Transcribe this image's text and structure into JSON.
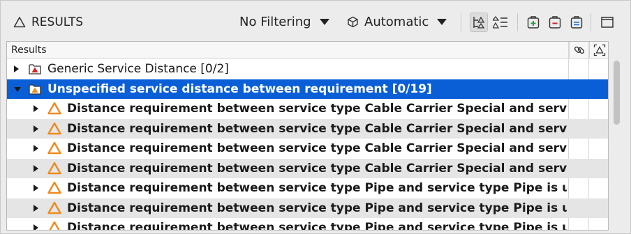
{
  "toolbar": {
    "title": "RESULTS",
    "filter_label": "No Filtering",
    "mode_label": "Automatic",
    "buttons": [
      "hierarchy-icon",
      "sort-list-icon",
      "expand-all-icon",
      "collapse-all-icon",
      "select-all-icon",
      "maximize-icon"
    ]
  },
  "table": {
    "header": "Results",
    "col_link_icon": "link-icon",
    "col_focus_icon": "focus-icon",
    "rows": [
      {
        "label": "Generic Service Distance [0/2]",
        "level": 0,
        "expanded": false,
        "icon": "folder-error-icon"
      },
      {
        "label": "Unspecified service distance between requirement [0/19]",
        "level": 0,
        "expanded": true,
        "icon": "folder-warning-icon",
        "selected": true
      },
      {
        "label": "Distance requirement between service type Cable Carrier Special and serv",
        "level": 1,
        "icon": "warning-icon"
      },
      {
        "label": "Distance requirement between service type Cable Carrier Special and serv",
        "level": 1,
        "icon": "warning-icon"
      },
      {
        "label": "Distance requirement between service type Cable Carrier Special and serv",
        "level": 1,
        "icon": "warning-icon"
      },
      {
        "label": "Distance requirement between service type Cable Carrier Special and serv",
        "level": 1,
        "icon": "warning-icon"
      },
      {
        "label": "Distance requirement between service type Pipe and service type Pipe is u",
        "level": 1,
        "icon": "warning-icon"
      },
      {
        "label": "Distance requirement between service type Pipe and service type Pipe is u",
        "level": 1,
        "icon": "warning-icon"
      },
      {
        "label": "Distance requirement between service type Pipe and service type Pipe is u",
        "level": 1,
        "icon": "warning-icon"
      }
    ]
  },
  "colors": {
    "selection": "#0a5fd7",
    "warning": "#f08a1c",
    "error": "#d91f1f"
  }
}
